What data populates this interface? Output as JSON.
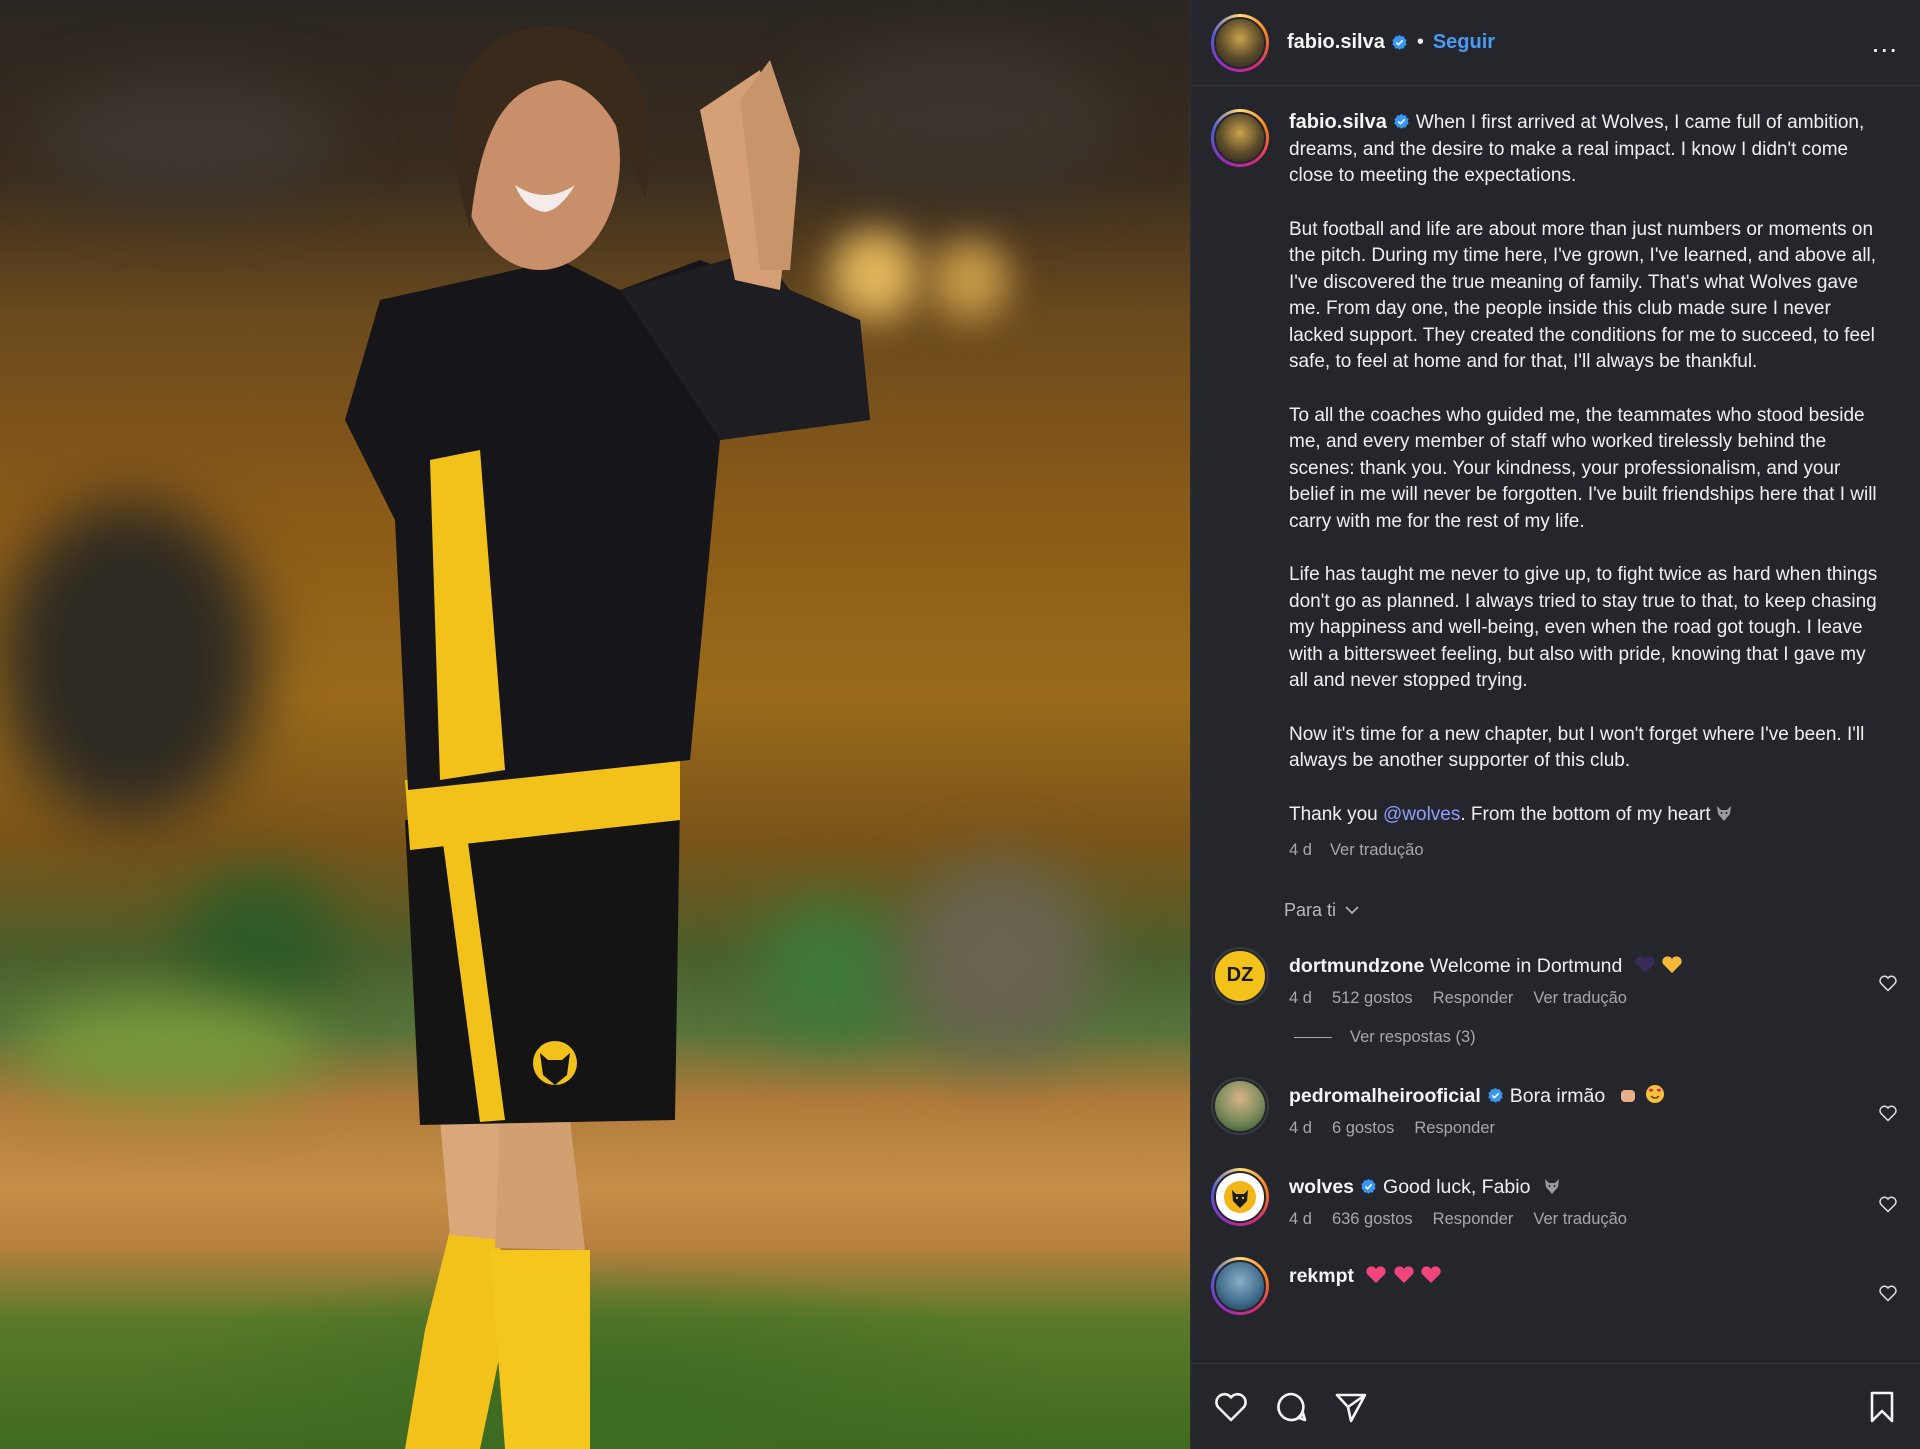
{
  "post": {
    "author": "fabio.silva",
    "follow_label": "Seguir",
    "separator": "•",
    "more_label": "..."
  },
  "caption": {
    "paragraphs": [
      "When I first arrived at Wolves, I came full of ambition, dreams, and the desire to make a real impact. I know I didn't come close to meeting the expectations.",
      "But football and life are about more than just numbers or moments on the pitch. During my time here, I've grown, I've learned, and above all, I've discovered the true meaning of family. That's what Wolves gave me. From day one, the people inside this club made sure I never lacked support. They created the conditions for me to succeed, to feel safe, to feel at home and for that, I'll always be thankful.",
      "To all the coaches who guided me, the teammates who stood beside me, and every member of staff who worked tirelessly behind the scenes: thank you. Your kindness, your professionalism, and your belief in me will never be forgotten. I've built friendships here that I will carry with me for the rest of my life.",
      "Life has taught me never to give up, to fight twice as hard when things don't go as planned. I always tried to stay true to that, to keep chasing my happiness and well-being, even when the road got tough. I leave with a bittersweet feeling, but also with pride, knowing that I gave my all and never stopped trying.",
      "Now it's time for a new chapter, but I won't forget where I've been. I'll always be another supporter of this club."
    ],
    "closing_prefix": "Thank you ",
    "closing_mention": "@wolves",
    "closing_suffix": ". From the bottom of my heart",
    "time": "4 d",
    "translate_label": "Ver tradução"
  },
  "sort": {
    "label": "Para ti"
  },
  "comments": [
    {
      "user": "dortmundzone",
      "text": "Welcome in Dortmund",
      "avatar_text": "DZ",
      "time": "4 d",
      "likes": "512 gostos",
      "reply_label": "Responder",
      "translate_label": "Ver tradução",
      "view_replies": "Ver respostas (3)"
    },
    {
      "user": "pedromalheirooficial",
      "text": "Bora irmão",
      "time": "4 d",
      "likes": "6 gostos",
      "reply_label": "Responder"
    },
    {
      "user": "wolves",
      "text": "Good luck, Fabio",
      "time": "4 d",
      "likes": "636 gostos",
      "reply_label": "Responder",
      "translate_label": "Ver tradução"
    },
    {
      "user": "rekmpt",
      "text": ""
    }
  ],
  "colors": {
    "panel_bg": "#25262b",
    "link_blue": "#4a9bf5",
    "mention": "#8f9eff",
    "muted": "#a8a8a8",
    "wolves_gold": "#f2b51a"
  },
  "icons": [
    "verified-badge-icon",
    "more-icon",
    "heart-icon",
    "comment-icon",
    "share-icon",
    "save-icon",
    "chevron-down-icon",
    "wolf-emoji-icon"
  ]
}
